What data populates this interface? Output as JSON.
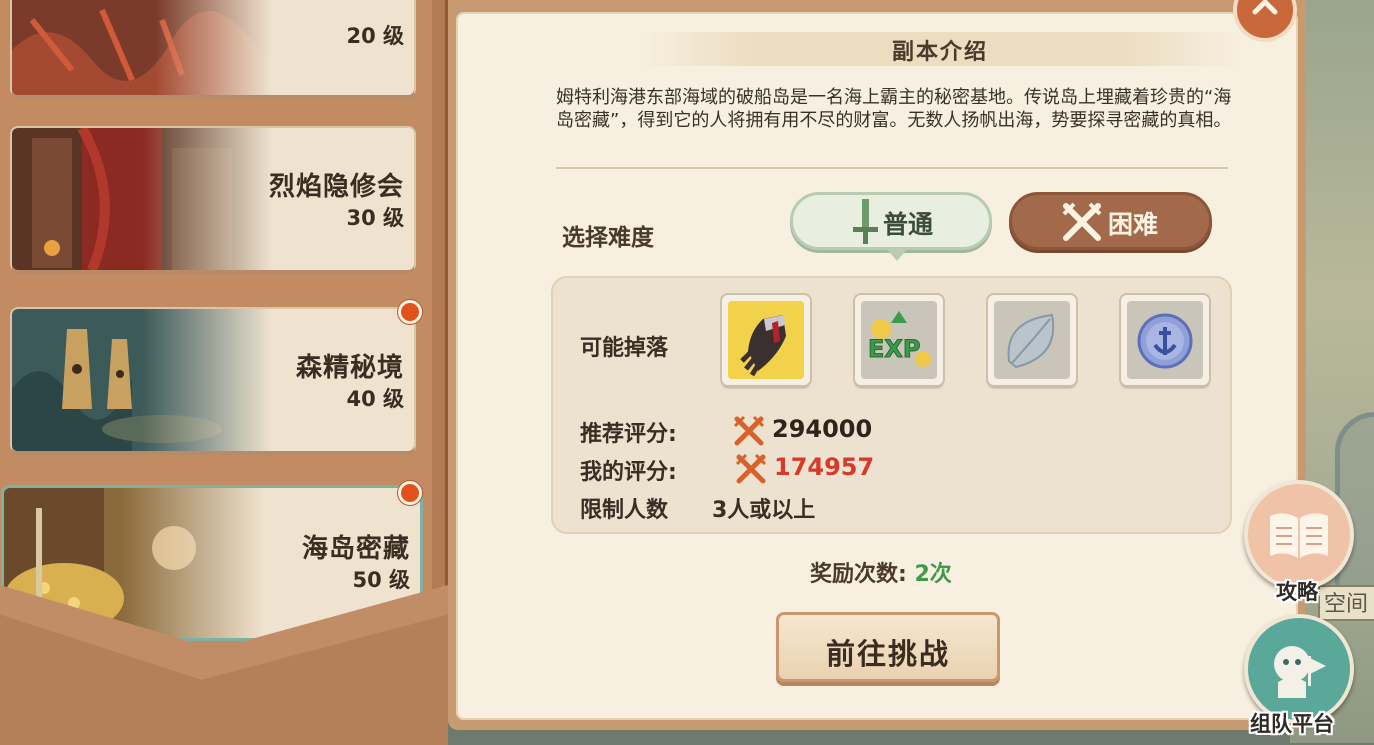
{
  "dungeon_list": [
    {
      "name": "",
      "level": "20 级",
      "has_alert": false,
      "selected": false
    },
    {
      "name": "烈焰隐修会",
      "level": "30 级",
      "has_alert": false,
      "selected": false
    },
    {
      "name": "森精秘境",
      "level": "40 级",
      "has_alert": true,
      "selected": false
    },
    {
      "name": "海岛密藏",
      "level": "50 级",
      "has_alert": true,
      "selected": true
    }
  ],
  "intro": {
    "title": "副本介绍",
    "description": "姆特利海港东部海域的破船岛是一名海上霸主的秘密基地。传说岛上埋藏着珍贵的“海岛密藏”，得到它的人将拥有用不尽的财富。无数人扬帆出海，势要探寻密藏的真相。"
  },
  "difficulty": {
    "label": "选择难度",
    "options": [
      {
        "label": "普通",
        "icon": "sword-icon",
        "selected": true
      },
      {
        "label": "困难",
        "icon": "crossed-swords-icon",
        "selected": false
      }
    ]
  },
  "drops": {
    "label": "可能掉落",
    "items": [
      {
        "icon": "gauntlet-icon",
        "rarity_color": "#f1d24a"
      },
      {
        "icon": "exp-icon",
        "rarity_color": "#c9c5b8"
      },
      {
        "icon": "leaf-icon",
        "rarity_color": "#c9c5b8"
      },
      {
        "icon": "anchor-coin-icon",
        "rarity_color": "#c9c5b8"
      }
    ]
  },
  "stats": {
    "recommended_label": "推荐评分:",
    "recommended_value": "294000",
    "my_label": "我的评分:",
    "my_value": "174957",
    "limit_label": "限制人数",
    "limit_value": "3人或以上"
  },
  "reward": {
    "label": "奖励次数:",
    "count": "2次"
  },
  "challenge_button": "前往挑战",
  "side_buttons": {
    "guide": "攻略",
    "team": "组队平台"
  },
  "map_text": "空间",
  "colors": {
    "warning_red": "#d63a2a",
    "reward_green": "#3d9a4a"
  }
}
